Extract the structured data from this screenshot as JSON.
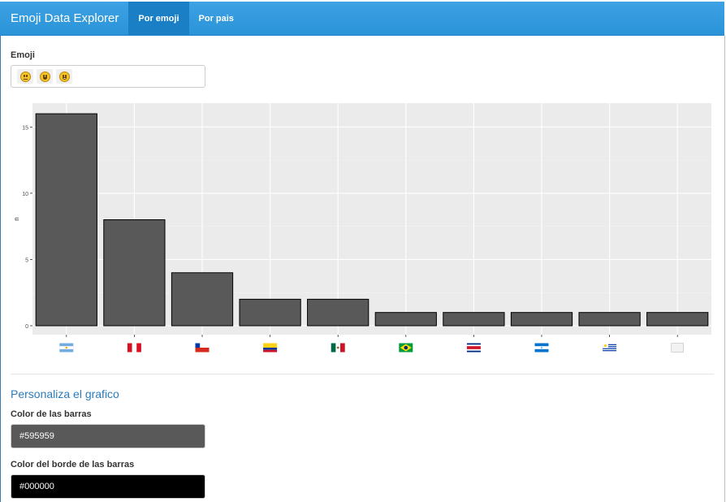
{
  "navbar": {
    "brand": "Emoji Data Explorer",
    "tabs": [
      {
        "label": "Por emoji",
        "active": true
      },
      {
        "label": "Por pais",
        "active": false
      }
    ]
  },
  "emoji_input": {
    "label": "Emoji",
    "selected": [
      "slightly-smiling-face",
      "grinning-face",
      "grinning-squinting-face"
    ]
  },
  "chart_data": {
    "type": "bar",
    "categories": [
      "Argentina",
      "Peru",
      "Chile",
      "Colombia",
      "Mexico",
      "Brazil",
      "Costa Rica",
      "Honduras",
      "Uruguay",
      "White flag"
    ],
    "values": [
      16,
      8,
      4,
      2,
      2,
      1,
      1,
      1,
      1,
      1
    ],
    "ylabel": "n",
    "xlabel": "",
    "ylim": [
      0,
      16.8
    ],
    "yticks": [
      0,
      5,
      10,
      15
    ],
    "bar_fill": "#595959",
    "bar_border": "#000000",
    "panel_background": "#ebebeb",
    "grid": true,
    "x_tick_icons": [
      "flag-argentina",
      "flag-peru",
      "flag-chile",
      "flag-colombia",
      "flag-mexico",
      "flag-brazil",
      "flag-costa-rica",
      "flag-honduras",
      "flag-uruguay",
      "white-flag"
    ]
  },
  "customize": {
    "title": "Personaliza el grafico",
    "bar_color_label": "Color de las barras",
    "bar_color_value": "#595959",
    "border_color_label": "Color del borde de las barras",
    "border_color_value": "#000000"
  },
  "colors": {
    "navbar": "#2a93d8",
    "active_tab": "#1a7fc4",
    "section_title": "#2b7bba"
  }
}
